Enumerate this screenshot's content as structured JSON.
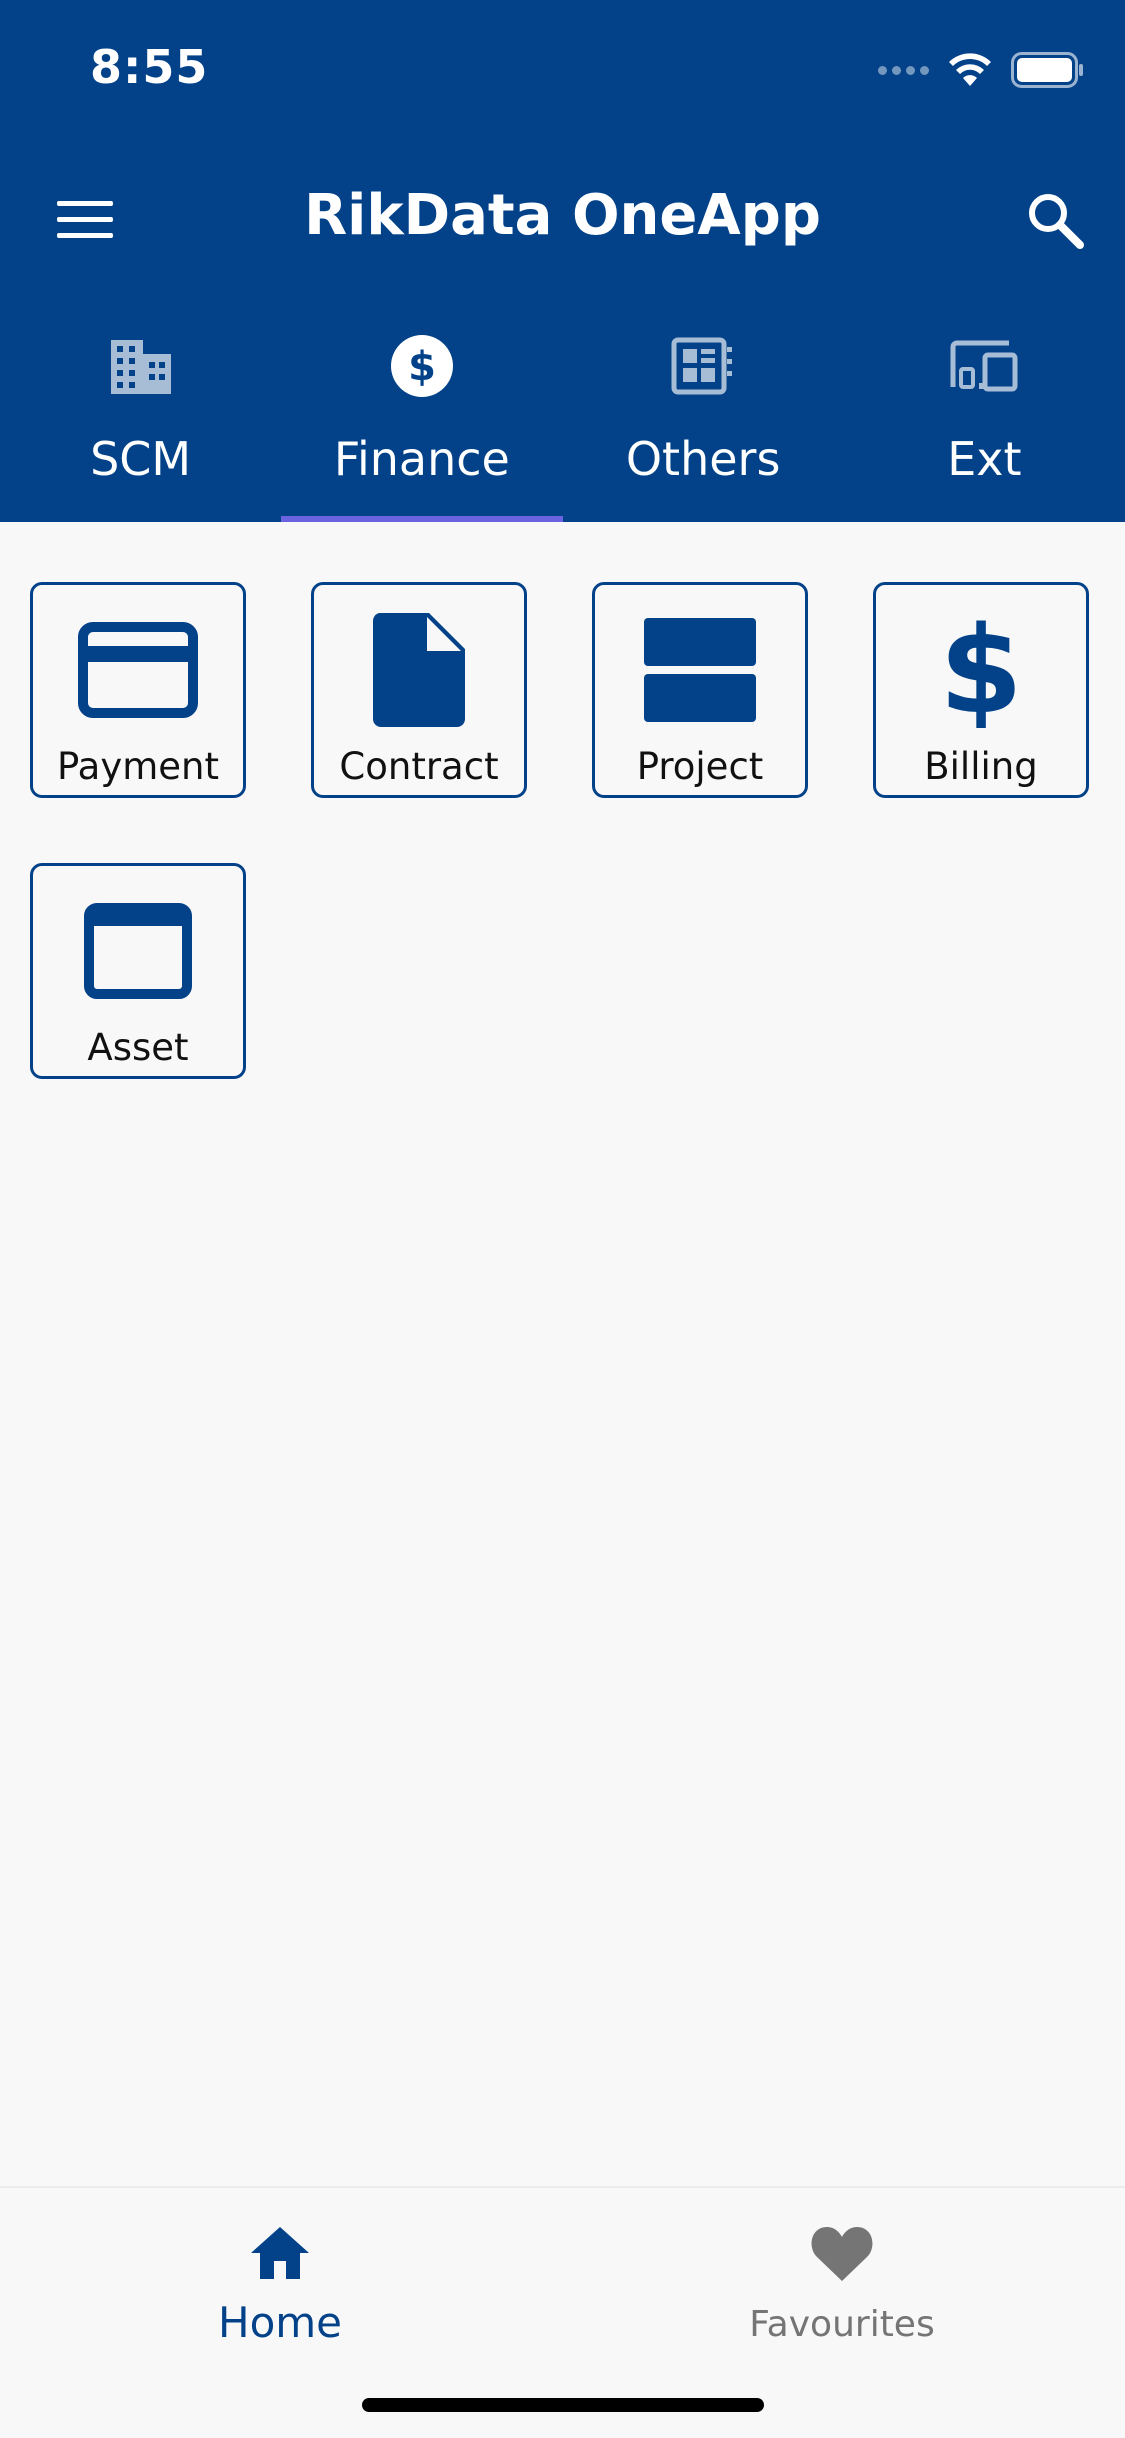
{
  "status_bar": {
    "time": "8:55"
  },
  "app_bar": {
    "title": "RikData OneApp",
    "menu_icon": "hamburger-menu-icon",
    "search_icon": "search-icon"
  },
  "tabs": [
    {
      "label": "SCM",
      "icon": "building-icon",
      "selected": false
    },
    {
      "label": "Finance",
      "icon": "dollar-circle-icon",
      "selected": true
    },
    {
      "label": "Others",
      "icon": "newspaper-icon",
      "selected": false
    },
    {
      "label": "Ext",
      "icon": "devices-icon",
      "selected": false
    }
  ],
  "tiles": [
    {
      "label": "Payment",
      "icon": "credit-card-icon"
    },
    {
      "label": "Contract",
      "icon": "document-icon"
    },
    {
      "label": "Project",
      "icon": "split-view-icon"
    },
    {
      "label": "Billing",
      "icon": "dollar-icon"
    },
    {
      "label": "Asset",
      "icon": "window-icon"
    }
  ],
  "bottom_nav": {
    "home": {
      "label": "Home",
      "icon": "home-icon",
      "selected": true
    },
    "favourites": {
      "label": "Favourites",
      "icon": "heart-icon",
      "selected": false
    }
  },
  "colors": {
    "primary": "#034289",
    "background": "#f8f8f8",
    "tab_indicator": "#6c63e0",
    "inactive_nav": "#757575"
  }
}
